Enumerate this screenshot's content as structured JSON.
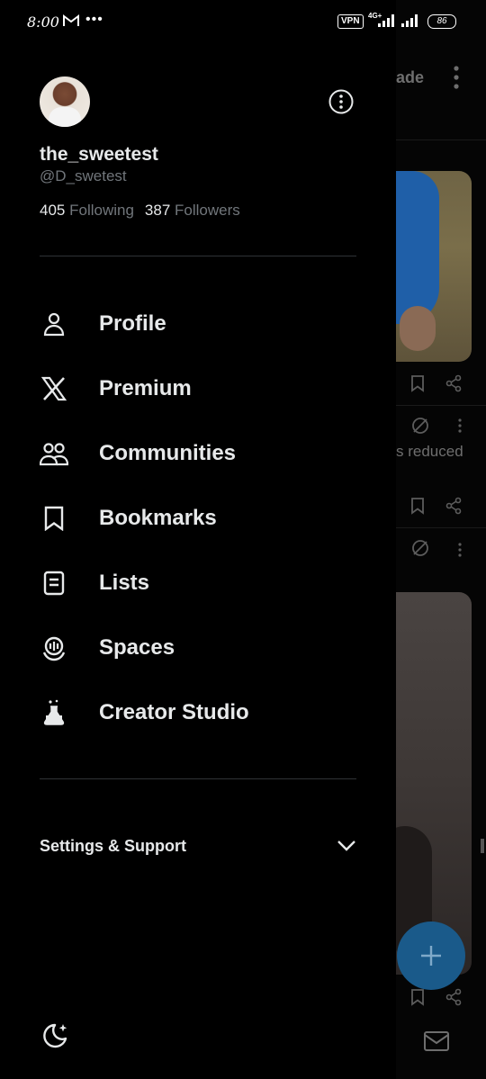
{
  "status_bar": {
    "time": "8:00",
    "dots": "•••",
    "vpn": "VPN",
    "network": "4G+",
    "battery": "86"
  },
  "profile": {
    "display_name": "the_sweetest",
    "handle": "@D_swetest",
    "following_count": "405",
    "following_label": "Following",
    "followers_count": "387",
    "followers_label": "Followers"
  },
  "menu": [
    {
      "label": "Profile",
      "icon": "person-icon"
    },
    {
      "label": "Premium",
      "icon": "x-logo-icon"
    },
    {
      "label": "Communities",
      "icon": "communities-icon"
    },
    {
      "label": "Bookmarks",
      "icon": "bookmark-icon"
    },
    {
      "label": "Lists",
      "icon": "list-icon"
    },
    {
      "label": "Spaces",
      "icon": "spaces-icon"
    },
    {
      "label": "Creator Studio",
      "icon": "creator-studio-icon"
    }
  ],
  "settings_support": {
    "label": "Settings & Support"
  },
  "background": {
    "header_fragment": "ade",
    "reduced_fragment": "s reduced"
  },
  "colors": {
    "background": "#000000",
    "text_primary": "#e7e9ea",
    "text_secondary": "#71767b",
    "divider": "#2f3336",
    "fab": "#1a5a8a"
  }
}
